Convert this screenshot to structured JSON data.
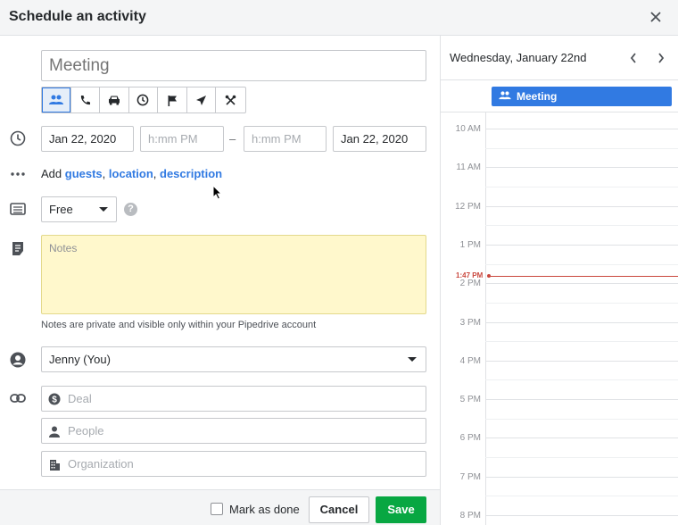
{
  "dialog": {
    "title": "Schedule an activity"
  },
  "subject": {
    "placeholder": "Meeting"
  },
  "types": [
    "meeting",
    "call",
    "car",
    "clock",
    "flag",
    "send",
    "lunch"
  ],
  "date": {
    "start_date": "Jan 22, 2020",
    "start_time_placeholder": "h:mm PM",
    "separator": "–",
    "end_time_placeholder": "h:mm PM",
    "end_date": "Jan 22, 2020"
  },
  "add": {
    "prefix": "Add",
    "guests": "guests",
    "location": "location",
    "description": "description",
    "comma": ",",
    "comma2": ","
  },
  "busy": {
    "value": "Free",
    "help": "?"
  },
  "notes": {
    "placeholder": "Notes",
    "hint": "Notes are private and visible only within your Pipedrive account"
  },
  "owner": {
    "value": "Jenny (You)"
  },
  "links": {
    "deal": "Deal",
    "people": "People",
    "organization": "Organization"
  },
  "footer": {
    "mark_done": "Mark as done",
    "cancel": "Cancel",
    "save": "Save"
  },
  "calendar": {
    "date": "Wednesday, January 22nd",
    "event": "Meeting",
    "hours": [
      "10 AM",
      "11 AM",
      "12 PM",
      "1 PM",
      "2 PM",
      "3 PM",
      "4 PM",
      "5 PM",
      "6 PM",
      "7 PM",
      "8 PM"
    ],
    "now": "1:47 PM"
  },
  "colors": {
    "accent": "#317ae2",
    "save": "#08a742",
    "notes_bg": "#fff8cc",
    "now": "#c9473d"
  }
}
